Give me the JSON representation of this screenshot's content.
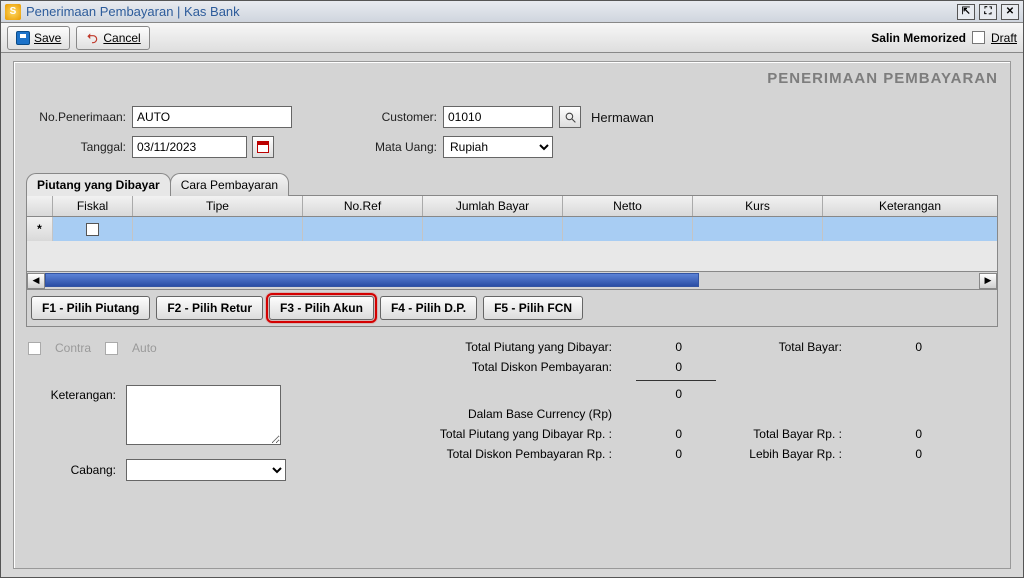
{
  "window": {
    "title": "Penerimaan Pembayaran | Kas Bank",
    "icon_letter": "S",
    "buttons": {
      "detach": "⇱",
      "maximize": "⛶",
      "close": "✕"
    }
  },
  "toolbar": {
    "save_label": "Save",
    "cancel_label": "Cancel",
    "memorized_label": "Salin Memorized",
    "draft_label": "Draft"
  },
  "heading": "PENERIMAAN PEMBAYARAN",
  "form": {
    "no_penerimaan_label": "No.Penerimaan:",
    "no_penerimaan_value": "AUTO",
    "tanggal_label": "Tanggal:",
    "tanggal_value": "03/11/2023",
    "customer_label": "Customer:",
    "customer_value": "01010",
    "customer_name": "Hermawan",
    "mata_uang_label": "Mata Uang:",
    "mata_uang_value": "Rupiah"
  },
  "tabs": {
    "tab1": "Piutang yang Dibayar",
    "tab2": "Cara Pembayaran"
  },
  "grid": {
    "headers": {
      "fiskal": "Fiskal",
      "tipe": "Tipe",
      "noref": "No.Ref",
      "jbayar": "Jumlah Bayar",
      "netto": "Netto",
      "kurs": "Kurs",
      "ket": "Keterangan"
    },
    "row_marker": "*"
  },
  "fkeys": {
    "f1": "F1 - Pilih Piutang",
    "f2": "F2 - Pilih Retur",
    "f3": "F3 - Pilih Akun",
    "f4": "F4 - Pilih D.P.",
    "f5": "F5 - Pilih FCN"
  },
  "options": {
    "contra": "Contra",
    "auto": "Auto"
  },
  "lower_left": {
    "keterangan_label": "Keterangan:",
    "cabang_label": "Cabang:",
    "cabang_value": ""
  },
  "totals": {
    "tpiutang_label": "Total Piutang yang Dibayar:",
    "tpiutang_value": "0",
    "tdiskon_label": "Total Diskon Pembayaran:",
    "tdiskon_value": "0",
    "subtotal_value": "0",
    "tbayar_label": "Total Bayar:",
    "tbayar_value": "0",
    "base_label": "Dalam Base Currency (Rp)",
    "tpiutang_rp_label": "Total Piutang yang Dibayar Rp. :",
    "tpiutang_rp_value": "0",
    "tdiskon_rp_label": "Total Diskon Pembayaran Rp. :",
    "tdiskon_rp_value": "0",
    "tbayar_rp_label": "Total Bayar Rp. :",
    "tbayar_rp_value": "0",
    "lebih_rp_label": "Lebih Bayar Rp. :",
    "lebih_rp_value": "0"
  }
}
